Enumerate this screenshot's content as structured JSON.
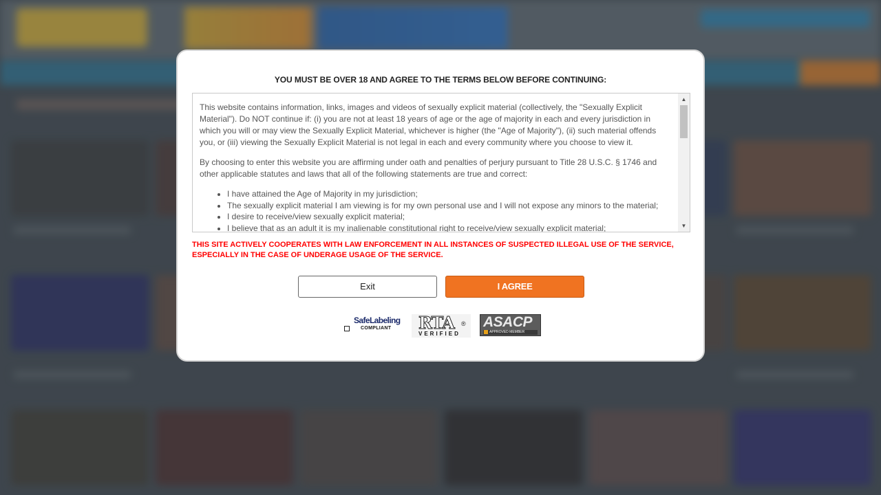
{
  "modal": {
    "title": "YOU MUST BE OVER 18 AND AGREE TO THE TERMS BELOW BEFORE CONTINUING:",
    "terms": {
      "paragraph_1": "This website contains information, links, images and videos of sexually explicit material (collectively, the \"Sexually Explicit Material\"). Do NOT continue if: (i) you are not at least 18 years of age or the age of majority in each and every jurisdiction in which you will or may view the Sexually Explicit Material, whichever is higher (the \"Age of Majority\"), (ii) such material offends you, or (iii) viewing the Sexually Explicit Material is not legal in each and every community where you choose to view it.",
      "paragraph_2": "By choosing to enter this website you are affirming under oath and penalties of perjury pursuant to Title 28 U.S.C. § 1746 and other applicable statutes and laws that all of the following statements are true and correct:",
      "items": [
        "I have attained the Age of Majority in my jurisdiction;",
        "The sexually explicit material I am viewing is for my own personal use and I will not expose any minors to the material;",
        "I desire to receive/view sexually explicit material;",
        "I believe that as an adult it is my inalienable constitutional right to receive/view sexually explicit material;"
      ]
    },
    "warning": "THIS SITE ACTIVELY COOPERATES WITH LAW ENFORCEMENT IN ALL INSTANCES OF SUSPECTED ILLEGAL USE OF THE SERVICE, ESPECIALLY IN THE CASE OF UNDERAGE USAGE OF THE SERVICE.",
    "buttons": {
      "exit_label": "Exit",
      "agree_label": "I AGREE"
    },
    "badges": {
      "safelabeling_title": "SafeLabeling",
      "safelabeling_sub": "COMPLIANT",
      "rta_title": "RTA",
      "rta_reg": "®",
      "rta_sub": "VERIFIED",
      "asacp_title": "ASACP",
      "asacp_sub": "APPROVED MEMBER"
    }
  },
  "colors": {
    "agree_button": "#f07321",
    "warning_text": "#ff0000"
  }
}
